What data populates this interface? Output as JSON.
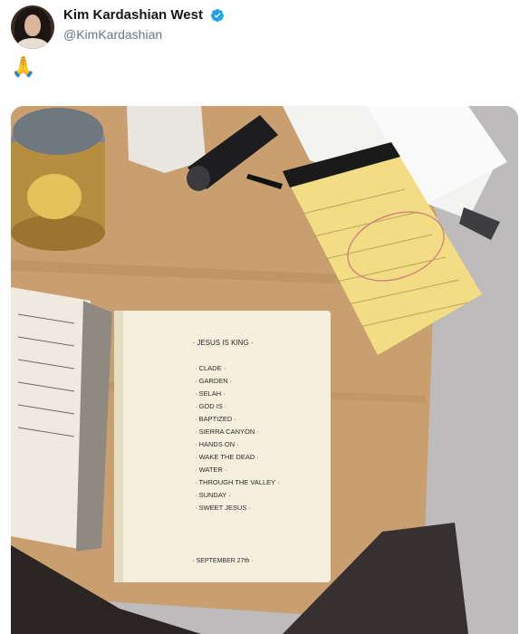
{
  "user": {
    "display_name": "Kim Kardashian West",
    "handle": "@KimKardashian",
    "verified_color": "#1da1f2"
  },
  "tweet": {
    "text": "🙏"
  },
  "photo": {
    "notebook_title": "· JESUS IS KING ·",
    "tracklist": [
      "· CLADE ·",
      "· GARDEN ·",
      "· SELAH ·",
      "· GOD IS ·",
      "· BAPTIZED ·",
      "· SIERRA CANYON ·",
      "· HANDS ON ·",
      "· WAKE THE DEAD ·",
      "· WATER ·",
      "· THROUGH THE VALLEY ·",
      "· SUNDAY ·",
      "· SWEET JESUS ·"
    ],
    "footer_date": "· SEPTEMBER 27th ·"
  }
}
